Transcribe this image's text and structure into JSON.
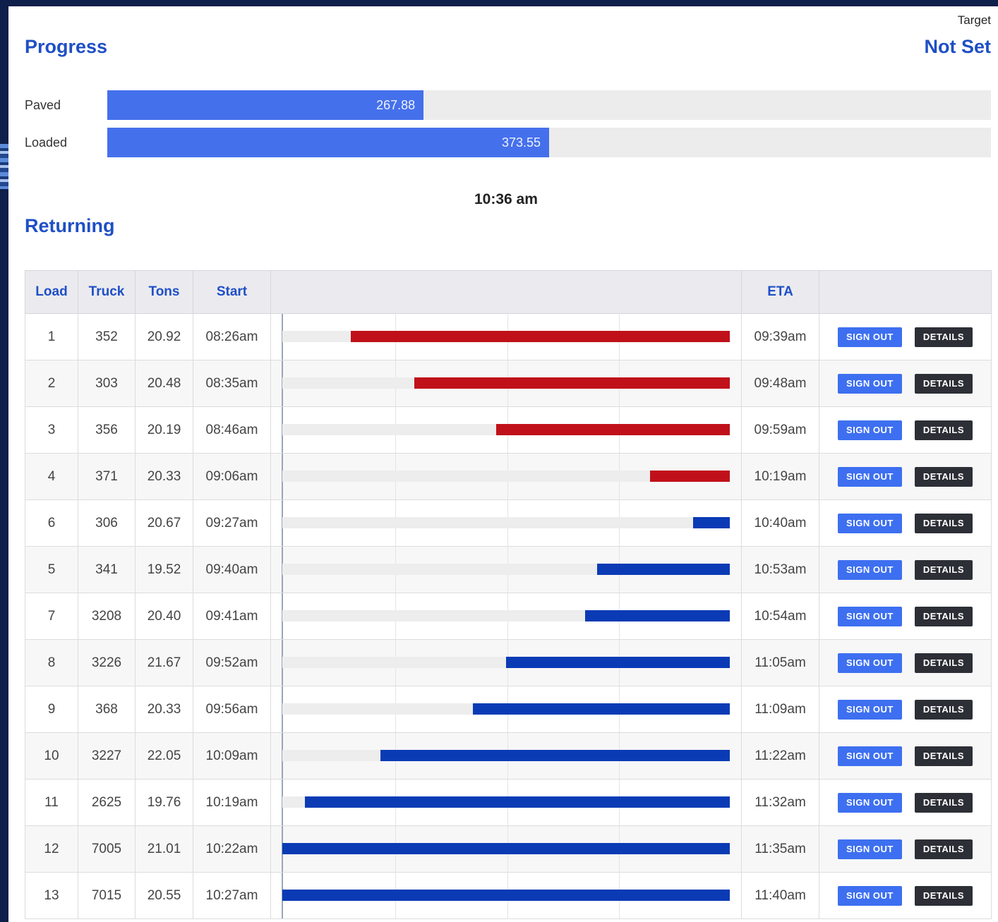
{
  "header": {
    "title": "Progress",
    "target_label": "Target",
    "target_value": "Not Set"
  },
  "progress": {
    "bars": [
      {
        "label": "Paved",
        "value": "267.88",
        "fraction": 0.358
      },
      {
        "label": "Loaded",
        "value": "373.55",
        "fraction": 0.5
      }
    ]
  },
  "clock": "10:36 am",
  "returning": {
    "title": "Returning",
    "columns": [
      "Load",
      "Truck",
      "Tons",
      "Start",
      "",
      "ETA",
      ""
    ],
    "sign_out_label": "SIGN OUT",
    "details_label": "DETAILS",
    "colors": {
      "overdue": "#c0111a",
      "enroute": "#0a3bb5",
      "track": "#ededed"
    },
    "rows": [
      {
        "load": "1",
        "truck": "352",
        "tons": "20.92",
        "start": "08:26am",
        "eta": "09:39am",
        "status": "overdue",
        "bar_start": 0.153,
        "bar_end": 1.0
      },
      {
        "load": "2",
        "truck": "303",
        "tons": "20.48",
        "start": "08:35am",
        "eta": "09:48am",
        "status": "overdue",
        "bar_start": 0.295,
        "bar_end": 1.0
      },
      {
        "load": "3",
        "truck": "356",
        "tons": "20.19",
        "start": "08:46am",
        "eta": "09:59am",
        "status": "overdue",
        "bar_start": 0.478,
        "bar_end": 1.0
      },
      {
        "load": "4",
        "truck": "371",
        "tons": "20.33",
        "start": "09:06am",
        "eta": "10:19am",
        "status": "overdue",
        "bar_start": 0.822,
        "bar_end": 1.0
      },
      {
        "load": "6",
        "truck": "306",
        "tons": "20.67",
        "start": "09:27am",
        "eta": "10:40am",
        "status": "enroute",
        "bar_start": 0.918,
        "bar_end": 1.0
      },
      {
        "load": "5",
        "truck": "341",
        "tons": "19.52",
        "start": "09:40am",
        "eta": "10:53am",
        "status": "enroute",
        "bar_start": 0.703,
        "bar_end": 1.0
      },
      {
        "load": "7",
        "truck": "3208",
        "tons": "20.40",
        "start": "09:41am",
        "eta": "10:54am",
        "status": "enroute",
        "bar_start": 0.676,
        "bar_end": 1.0
      },
      {
        "load": "8",
        "truck": "3226",
        "tons": "21.67",
        "start": "09:52am",
        "eta": "11:05am",
        "status": "enroute",
        "bar_start": 0.5,
        "bar_end": 1.0
      },
      {
        "load": "9",
        "truck": "368",
        "tons": "20.33",
        "start": "09:56am",
        "eta": "11:09am",
        "status": "enroute",
        "bar_start": 0.426,
        "bar_end": 1.0
      },
      {
        "load": "10",
        "truck": "3227",
        "tons": "22.05",
        "start": "10:09am",
        "eta": "11:22am",
        "status": "enroute",
        "bar_start": 0.219,
        "bar_end": 1.0
      },
      {
        "load": "11",
        "truck": "2625",
        "tons": "19.76",
        "start": "10:19am",
        "eta": "11:32am",
        "status": "enroute",
        "bar_start": 0.05,
        "bar_end": 1.0
      },
      {
        "load": "12",
        "truck": "7005",
        "tons": "21.01",
        "start": "10:22am",
        "eta": "11:35am",
        "status": "enroute",
        "bar_start": 0.0,
        "bar_end": 1.0
      },
      {
        "load": "13",
        "truck": "7015",
        "tons": "20.55",
        "start": "10:27am",
        "eta": "11:40am",
        "status": "enroute",
        "bar_start": 0.0,
        "bar_end": 1.0
      }
    ]
  }
}
